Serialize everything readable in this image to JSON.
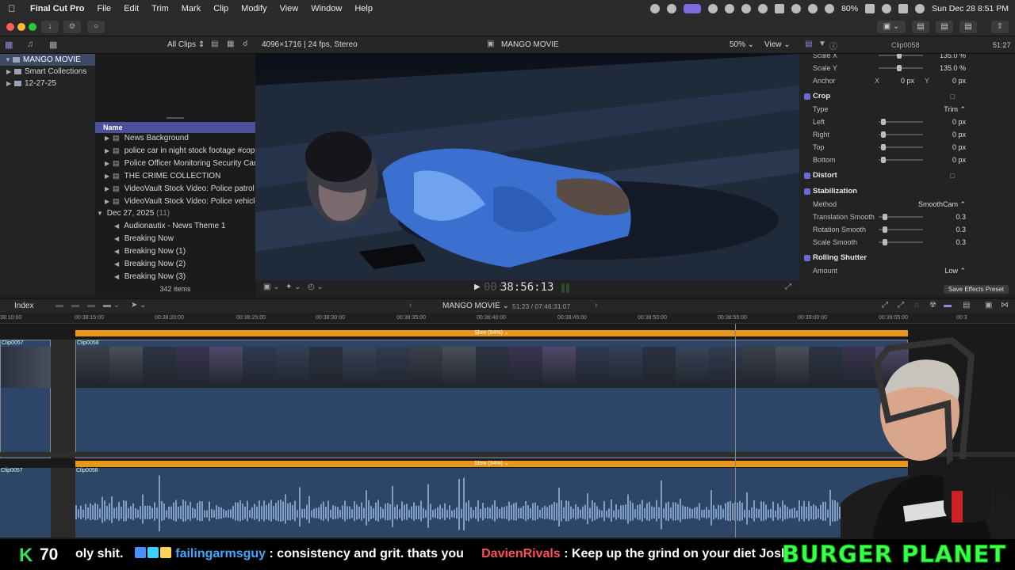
{
  "menubar": {
    "app_name": "Final Cut Pro",
    "items": [
      "File",
      "Edit",
      "Trim",
      "Mark",
      "Clip",
      "Modify",
      "View",
      "Window",
      "Help"
    ],
    "battery": "80%",
    "datetime": "Sun Dec 28  8:51 PM"
  },
  "library": {
    "clips_filter": "All Clips",
    "name": "MANGO MOVIE",
    "sidebar_items": [
      "MANGO MOVIE",
      "Smart Collections",
      "12-27-25"
    ]
  },
  "browser": {
    "column_header": "Name",
    "clips": [
      "News Background",
      "police  car in night stock footage #copyri",
      "Police Officer Monitoring Security Camer",
      "THE CRIME COLLECTION",
      "VideoVault Stock Video:   Police patrol ca",
      "VideoVault Stock Video:   Police vehicles"
    ],
    "group_date": "Dec 27, 2025",
    "group_count": "(11)",
    "group_clips": [
      "Audionautix - News Theme 1",
      "Breaking Now",
      "Breaking Now (1)",
      "Breaking Now (2)",
      "Breaking Now (3)"
    ],
    "item_count": "342 items"
  },
  "viewer": {
    "format": "4096×1716 | 24 fps, Stereo",
    "title": "MANGO MOVIE",
    "zoom": "50%",
    "view_label": "View",
    "timecode": "38:56:13",
    "timecode_prefix": "00:"
  },
  "inspector": {
    "clip_name": "Clip0058",
    "duration": "51:27",
    "rows": [
      {
        "kind": "param",
        "label": "Scale X",
        "value": "135.0  %",
        "knob": 0.45
      },
      {
        "kind": "param",
        "label": "Scale Y",
        "value": "135.0  %",
        "knob": 0.45
      },
      {
        "kind": "anchor",
        "label": "Anchor",
        "x_label": "X",
        "x_value": "0  px",
        "y_label": "Y",
        "y_value": "0  px"
      },
      {
        "kind": "section",
        "label": "Crop"
      },
      {
        "kind": "select",
        "label": "Type",
        "value": "Trim ⌃"
      },
      {
        "kind": "param",
        "label": "Left",
        "value": "0  px",
        "knob": 0.05
      },
      {
        "kind": "param",
        "label": "Right",
        "value": "0  px",
        "knob": 0.05
      },
      {
        "kind": "param",
        "label": "Top",
        "value": "0  px",
        "knob": 0.05
      },
      {
        "kind": "param",
        "label": "Bottom",
        "value": "0  px",
        "knob": 0.05
      },
      {
        "kind": "section",
        "label": "Distort"
      },
      {
        "kind": "section",
        "label": "Stabilization"
      },
      {
        "kind": "select",
        "label": "Method",
        "value": "SmoothCam ⌃"
      },
      {
        "kind": "param",
        "label": "Translation Smooth",
        "value": "0.3",
        "knob": 0.1
      },
      {
        "kind": "param",
        "label": "Rotation Smooth",
        "value": "0.3",
        "knob": 0.1
      },
      {
        "kind": "param",
        "label": "Scale Smooth",
        "value": "0.3",
        "knob": 0.1
      },
      {
        "kind": "section",
        "label": "Rolling Shutter"
      },
      {
        "kind": "select",
        "label": "Amount",
        "value": "Low ⌃"
      }
    ],
    "save_preset": "Save Effects Preset"
  },
  "timeline": {
    "index_label": "Index",
    "project": "MANGO MOVIE",
    "position": "51:23 / 07:46:31:07",
    "ruler": [
      "38:10:00",
      "00:38:15:00",
      "00:38:20:00",
      "00:38:25:00",
      "00:38:30:00",
      "00:38:35:00",
      "00:38:40:00",
      "00:38:45:00",
      "00:38:50:00",
      "00:38:55:00",
      "00:39:00:00",
      "00:39:05:00",
      "00:3"
    ],
    "speed_label": "Slow (94%) ⌄",
    "clip_prev": "Clip0057",
    "clip_main": "Clip0058"
  },
  "chat": {
    "kick_logo": "K",
    "viewer_count": "70",
    "messages": [
      {
        "user": "",
        "text": "oly shit."
      },
      {
        "user": "failingarmsguy",
        "text": ": consistency and grit. thats you"
      },
      {
        "user": "DavienRivals",
        "text": ": Keep up the grind on your diet Josh"
      }
    ],
    "sponsor": "BURGER PLANET"
  }
}
